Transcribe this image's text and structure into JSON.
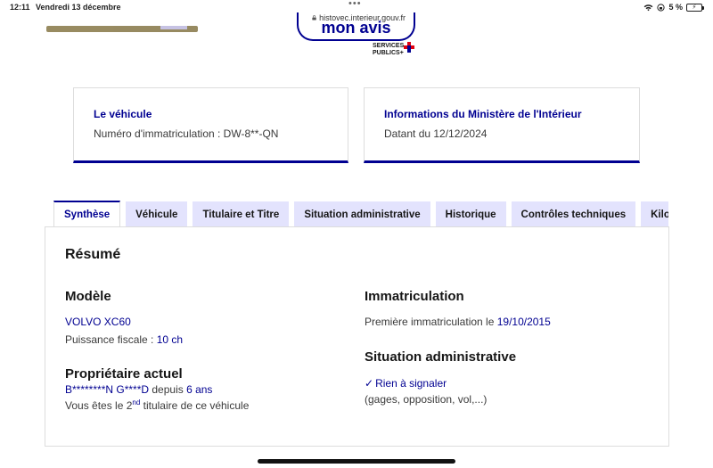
{
  "status_bar": {
    "time": "12:11",
    "date": "Vendredi 13 décembre",
    "url": "histovec.interieur.gouv.fr",
    "battery": "5 %"
  },
  "header": {
    "feedback_label": "mon avis",
    "services_line1": "SERVICES",
    "services_line2": "PUBLICS+"
  },
  "vehicle_card": {
    "title": "Le véhicule",
    "text": "Numéro d'immatriculation : DW-8**-QN"
  },
  "ministry_card": {
    "title": "Informations du Ministère de l'Intérieur",
    "text": "Datant du 12/12/2024"
  },
  "tabs": [
    {
      "label": "Synthèse",
      "active": true
    },
    {
      "label": "Véhicule"
    },
    {
      "label": "Titulaire et Titre"
    },
    {
      "label": "Situation administrative"
    },
    {
      "label": "Historique"
    },
    {
      "label": "Contrôles techniques"
    },
    {
      "label": "Kilo"
    }
  ],
  "summary": {
    "heading": "Résumé",
    "model": {
      "title": "Modèle",
      "name": "VOLVO XC60",
      "fiscal_label": "Puissance fiscale : ",
      "fiscal_value": "10 ch"
    },
    "owner": {
      "title": "Propriétaire actuel",
      "name": "B********N G****D",
      "since_label": " depuis ",
      "since_value": "6 ans",
      "holder_prefix": "Vous êtes le 2",
      "holder_sup": "nd",
      "holder_suffix": " titulaire de ce véhicule"
    },
    "registration": {
      "title": "Immatriculation",
      "first_label": "Première immatriculation le ",
      "first_date": "19/10/2015"
    },
    "admin": {
      "title": "Situation administrative",
      "status": "Rien à signaler",
      "detail": "(gages, opposition, vol,...)"
    }
  },
  "colors": {
    "primary": "#000091",
    "tab_background": "#e3e3fd",
    "border": "#dddddd"
  }
}
